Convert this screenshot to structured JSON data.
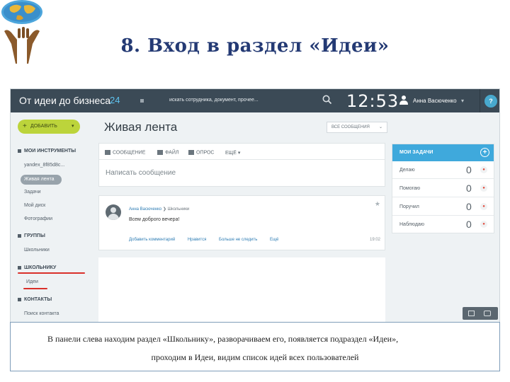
{
  "slide": {
    "title": "8. Вход в раздел «Идеи»"
  },
  "topbar": {
    "app_title": "От идеи до бизнеса",
    "count": "24",
    "search_placeholder": "искать сотрудника, документ, прочее...",
    "clock": "12:53",
    "user_name": "Анна Васюченко",
    "help_label": "?"
  },
  "sidebar": {
    "add_button": "ДОБАВИТЬ",
    "my_tools": "МОИ ИНСТРУМЕНТЫ",
    "yandex_item": "yandex_8f85d8c...",
    "live_feed": "Живая лента",
    "tasks": "Задачи",
    "my_disk": "Мой диск",
    "photos": "Фотографии",
    "groups": "ГРУППЫ",
    "schoolchildren": "Школьники",
    "for_school": "ШКОЛЬНИКУ",
    "ideas": "Идеи",
    "contacts": "КОНТАКТЫ",
    "contact_search": "Поиск контакта"
  },
  "feed": {
    "title": "Живая лента",
    "filter": "ВСЕ СООБЩЕНИЯ",
    "tabs": [
      "СООБЩЕНИЕ",
      "ФАЙЛ",
      "ОПРОС",
      "ЕЩЁ"
    ],
    "compose_placeholder": "Написать сообщение",
    "post": {
      "author": "Анна Васюченко",
      "destination": "Школьники",
      "text": "Всем доброго вечера!",
      "actions": [
        "Добавить комментарий",
        "Нравится",
        "Больше не следить",
        "Ещё"
      ],
      "time": "19:02"
    }
  },
  "tasks_widget": {
    "title": "МОИ ЗАДАЧИ",
    "rows": [
      {
        "label": "Делаю",
        "count": "0"
      },
      {
        "label": "Помогаю",
        "count": "0"
      },
      {
        "label": "Поручил",
        "count": "0"
      },
      {
        "label": "Наблюдаю",
        "count": "0"
      }
    ]
  },
  "caption": {
    "line1": "В панели слева находим раздел «Школьнику», разворачиваем его, появляется подраздел «Идеи»,",
    "line2": "проходим в Идеи, видим список идей всех пользователей"
  },
  "colors": {
    "topbar": "#3b4a56",
    "accent_blue": "#3fa9dc",
    "add_button": "#bcd43b",
    "underline_red": "#d9302a",
    "title_navy": "#243a74"
  }
}
